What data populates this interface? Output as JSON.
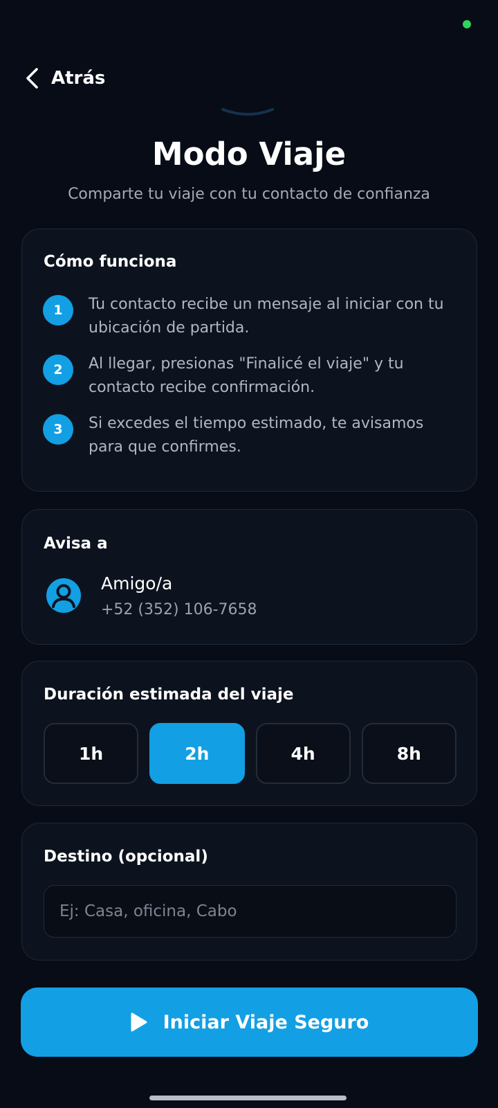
{
  "header": {
    "back_label": "Atrás",
    "title": "Modo Viaje",
    "subtitle": "Comparte tu viaje con tu contacto de confianza"
  },
  "how_it_works": {
    "title": "Cómo funciona",
    "steps": [
      {
        "number": "1",
        "text": "Tu contacto recibe un mensaje al iniciar con tu ubicación de partida."
      },
      {
        "number": "2",
        "text": "Al llegar, presionas \"Finalicé el viaje\" y tu contacto recibe confirmación."
      },
      {
        "number": "3",
        "text": "Si excedes el tiempo estimado, te avisamos para que confirmes."
      }
    ]
  },
  "notify": {
    "title": "Avisa a",
    "contact_name": "Amigo/a",
    "contact_phone": "+52 (352) 106-7658",
    "avatar_icon": "person-circle-icon"
  },
  "duration": {
    "title": "Duración estimada del viaje",
    "options": [
      "1h",
      "2h",
      "4h",
      "8h"
    ],
    "selected": "2h"
  },
  "destination": {
    "title": "Destino (opcional)",
    "value": "",
    "placeholder": "Ej: Casa, oficina, Cabo"
  },
  "start_button": {
    "label": "Iniciar Viaje Seguro",
    "icon": "play-icon"
  },
  "colors": {
    "accent": "#139fe3",
    "background": "#070c16",
    "card": "#0d131e",
    "status_online": "#2fd35a"
  }
}
